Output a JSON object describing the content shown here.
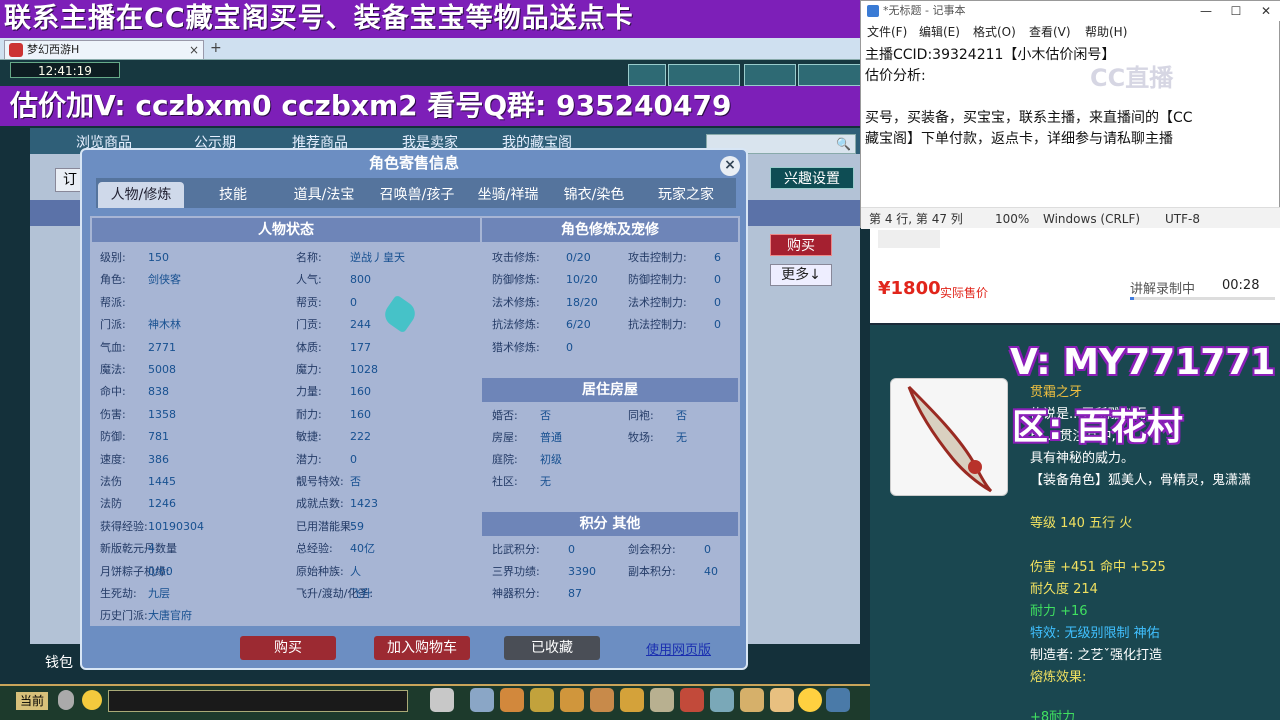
{
  "game": {
    "top_banner": "联系主播在CC藏宝阁买号、装备宝宝等物品送点卡",
    "ad_banner": "估价加V:  cczbxm0   cczbxm2   看号Q群: 935240479",
    "browser_tab": "梦幻西游H",
    "tab_close": "×",
    "tab_add": "+",
    "clock": "12:41:19",
    "nav": [
      "浏览商品",
      "公示期",
      "推荐商品",
      "我是卖家",
      "我的藏宝阁"
    ],
    "side": {
      "ding": "订",
      "xingqu": "兴趣设置",
      "buy": "购买",
      "more": "更多↓",
      "qianbao": "钱包",
      "dangqian": "当前"
    }
  },
  "dialog": {
    "title": "角色寄售信息",
    "close": "×",
    "tabs": [
      "人物/修炼",
      "技能",
      "道具/法宝",
      "召唤兽/孩子",
      "坐骑/祥瑞",
      "锦衣/染色",
      "玩家之家"
    ],
    "status_head": "人物状态",
    "left_col": [
      [
        "级别:",
        "150"
      ],
      [
        "角色:",
        "剑侠客"
      ],
      [
        "帮派:",
        ""
      ],
      [
        "门派:",
        "神木林"
      ],
      [
        "气血:",
        "2771"
      ],
      [
        "魔法:",
        "5008"
      ],
      [
        "命中:",
        "838"
      ],
      [
        "伤害:",
        "1358"
      ],
      [
        "防御:",
        "781"
      ],
      [
        "速度:",
        "386"
      ],
      [
        "法伤",
        "1445"
      ],
      [
        "法防",
        "1246"
      ],
      [
        "获得经验:",
        "10190304"
      ],
      [
        "新版乾元丹数量",
        "4"
      ],
      [
        "月饼粽子机缘:",
        "0/60"
      ],
      [
        "生死劫:",
        "九层"
      ],
      [
        "历史门派:",
        "大唐官府"
      ]
    ],
    "mid_col": [
      [
        "名称:",
        "逆战丿皇天"
      ],
      [
        "人气:",
        "800"
      ],
      [
        "帮贡:",
        "0"
      ],
      [
        "门贡:",
        "244"
      ],
      [
        "体质:",
        "177"
      ],
      [
        "魔力:",
        "1028"
      ],
      [
        "力量:",
        "160"
      ],
      [
        "耐力:",
        "160"
      ],
      [
        "敏捷:",
        "222"
      ],
      [
        "潜力:",
        "0"
      ],
      [
        "靓号特效:",
        "否"
      ],
      [
        "成就点数:",
        "1423"
      ],
      [
        "已用潜能果:",
        "59"
      ],
      [
        "总经验:",
        "40亿"
      ],
      [
        "原始种族:",
        "人"
      ],
      [
        "飞升/渡劫/化圣:",
        "飞升"
      ]
    ],
    "cultivation_head": "角色修炼及宠修",
    "cult_left": [
      [
        "攻击修炼:",
        "0/20"
      ],
      [
        "防御修炼:",
        "10/20"
      ],
      [
        "法术修炼:",
        "18/20"
      ],
      [
        "抗法修炼:",
        "6/20"
      ],
      [
        "猎术修炼:",
        "0"
      ]
    ],
    "cult_right": [
      [
        "攻击控制力:",
        "6"
      ],
      [
        "防御控制力:",
        "0"
      ],
      [
        "法术控制力:",
        "0"
      ],
      [
        "抗法控制力:",
        "0"
      ]
    ],
    "house_head": "居住房屋",
    "house_left": [
      [
        "婚否:",
        "否"
      ],
      [
        "房屋:",
        "普通"
      ],
      [
        "庭院:",
        "初级"
      ],
      [
        "社区:",
        "无"
      ]
    ],
    "house_right": [
      [
        "同袍:",
        "否"
      ],
      [
        "牧场:",
        "无"
      ]
    ],
    "score_head": "积分 其他",
    "score_left": [
      [
        "比武积分:",
        "0"
      ],
      [
        "三界功绩:",
        "3390"
      ],
      [
        "神器积分:",
        "87"
      ]
    ],
    "score_right": [
      [
        "剑会积分:",
        "0"
      ],
      [
        "副本积分:",
        "40"
      ]
    ],
    "buttons": {
      "buy": "购买",
      "cart": "加入购物车",
      "fav": "已收藏",
      "web": "使用网页版"
    }
  },
  "notepad": {
    "title": "*无标题 - 记事本",
    "menu": [
      "文件(F)",
      "编辑(E)",
      "格式(O)",
      "查看(V)",
      "帮助(H)"
    ],
    "lines": [
      "主播CCID:39324211【小木估价闲号】",
      "估价分析:",
      "",
      "买号，买装备，买宝宝，联系主播，来直播间的【CC",
      "藏宝阁】下单付款，返点卡，详细参与请私聊主播"
    ],
    "status": [
      "第 4 行, 第 47 列",
      "100%",
      "Windows (CRLF)",
      "UTF-8"
    ],
    "winbtns": [
      "—",
      "☐",
      "✕"
    ]
  },
  "watermark": "CC直播",
  "store": {
    "price": "¥1800",
    "price_sub": "实际售价",
    "recording": "讲解录制中",
    "time": "00:28",
    "progress_fraction": 0.03
  },
  "tooltip": {
    "big_v": "V: MY771771",
    "big_qu": "区: 百花村",
    "name": "贯霜之牙",
    "desc1": "传说是...牙所雕刻而",
    "desc2": "成,...贯注其中,",
    "desc3": "具有神秘的威力。",
    "roles": "【装备角色】狐美人，骨精灵，鬼潇潇",
    "level": "等级 140  五行 火",
    "dmg": "伤害 +451  命中 +525",
    "durability": "耐久度 214",
    "stamina": "耐力 +16",
    "effect": "特效: 无级别限制 神佑",
    "maker": "制造者: 之艺ˇ强化打造",
    "melting": "熔炼效果:",
    "extra": "+8耐力"
  },
  "colors": {
    "accent_purple": "#7d1fb8",
    "buy_red": "#a52030",
    "price_red": "#e1251b"
  }
}
